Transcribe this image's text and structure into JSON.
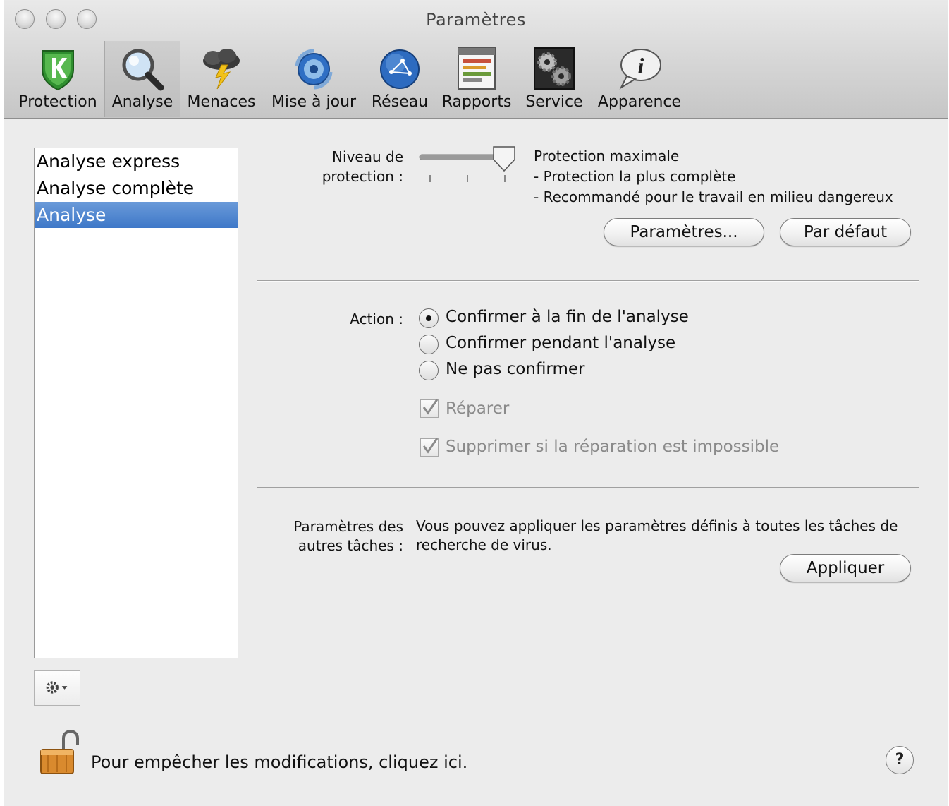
{
  "window": {
    "title": "Paramètres"
  },
  "toolbar": {
    "items": [
      {
        "label": "Protection",
        "icon": "protection-shield-icon"
      },
      {
        "label": "Analyse",
        "icon": "magnifier-icon",
        "selected": true
      },
      {
        "label": "Menaces",
        "icon": "storm-cloud-icon"
      },
      {
        "label": "Mise à jour",
        "icon": "update-globe-icon"
      },
      {
        "label": "Réseau",
        "icon": "network-globe-icon"
      },
      {
        "label": "Rapports",
        "icon": "reports-icon"
      },
      {
        "label": "Service",
        "icon": "service-gears-icon"
      },
      {
        "label": "Apparence",
        "icon": "info-bubble-icon"
      }
    ]
  },
  "task_list": {
    "items": [
      "Analyse express",
      "Analyse complète",
      "Analyse"
    ],
    "selected_index": 2
  },
  "protection": {
    "label_line1": "Niveau de",
    "label_line2": "protection :",
    "slider_level": 3,
    "slider_steps": 3,
    "title": "Protection maximale",
    "desc1": "- Protection la plus complète",
    "desc2": "- Recommandé pour le travail en milieu dangereux",
    "settings_button": "Paramètres...",
    "default_button": "Par défaut"
  },
  "action": {
    "label": "Action :",
    "options": [
      "Confirmer à la fin de l'analyse",
      "Confirmer pendant l'analyse",
      "Ne pas confirmer"
    ],
    "selected_index": 0,
    "repair_label": "Réparer",
    "repair_checked": true,
    "delete_label": "Supprimer si la réparation est impossible",
    "delete_checked": true
  },
  "other_tasks": {
    "label_line1": "Paramètres des",
    "label_line2": "autres tâches :",
    "desc_line1": "Vous pouvez appliquer les paramètres définis à toutes les tâches de",
    "desc_line2": "recherche de virus.",
    "apply_button": "Appliquer"
  },
  "footer": {
    "lock_text": "Pour empêcher les modifications, cliquez ici.",
    "help_label": "?"
  }
}
